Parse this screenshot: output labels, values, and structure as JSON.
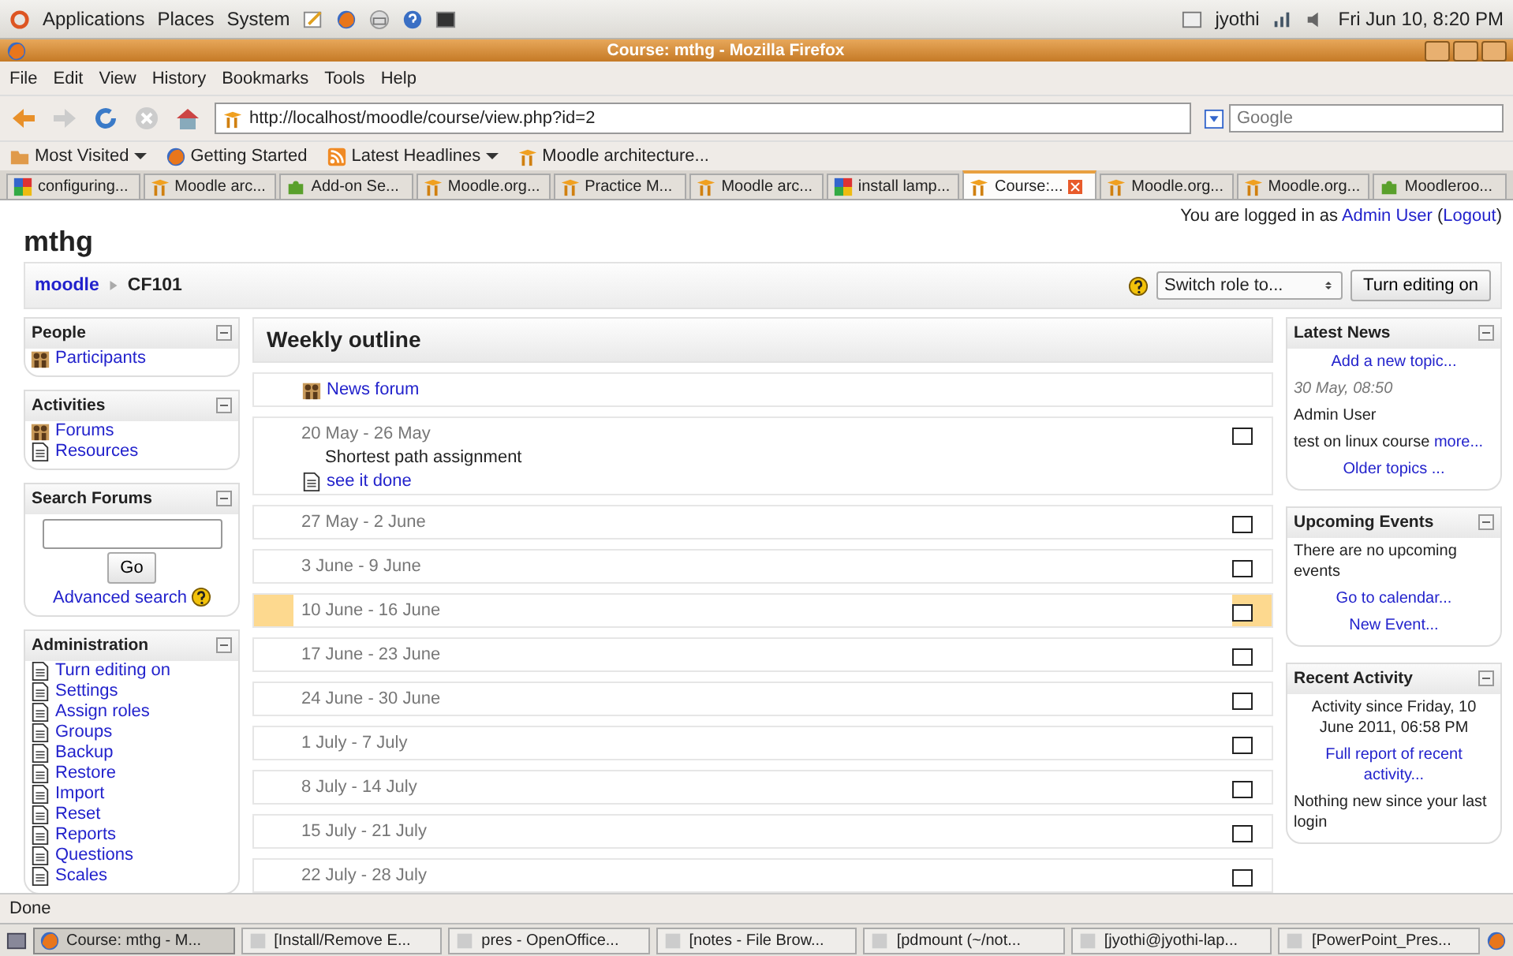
{
  "desktop_panel": {
    "menus": [
      "Applications",
      "Places",
      "System"
    ],
    "user": "jyothi",
    "clock": "Fri Jun 10, 8:20 PM"
  },
  "window": {
    "title": "Course: mthg - Mozilla Firefox"
  },
  "menu_bar": [
    "File",
    "Edit",
    "View",
    "History",
    "Bookmarks",
    "Tools",
    "Help"
  ],
  "address_bar": {
    "value": "http://localhost/moodle/course/view.php?id=2"
  },
  "search_bar": {
    "placeholder": "Google"
  },
  "bookmarks": [
    {
      "label": "Most Visited",
      "kind": "folder",
      "menu": true
    },
    {
      "label": "Getting Started",
      "kind": "firefox",
      "menu": false
    },
    {
      "label": "Latest Headlines",
      "kind": "feed",
      "menu": true
    },
    {
      "label": "Moodle architecture...",
      "kind": "moodle",
      "menu": false
    }
  ],
  "browser_tabs": [
    {
      "label": "configuring...",
      "kind": "google",
      "selected": false
    },
    {
      "label": "Moodle arc...",
      "kind": "moodle",
      "selected": false
    },
    {
      "label": "Add-on Se...",
      "kind": "addon",
      "selected": false
    },
    {
      "label": "Moodle.org...",
      "kind": "moodle",
      "selected": false
    },
    {
      "label": "Practice M...",
      "kind": "moodle",
      "selected": false
    },
    {
      "label": "Moodle arc...",
      "kind": "moodle",
      "selected": false
    },
    {
      "label": "install lamp...",
      "kind": "google",
      "selected": false
    },
    {
      "label": "Course:...",
      "kind": "moodle",
      "selected": true
    },
    {
      "label": "Moodle.org...",
      "kind": "moodle",
      "selected": false
    },
    {
      "label": "Moodle.org...",
      "kind": "moodle",
      "selected": false
    },
    {
      "label": "Moodleroo...",
      "kind": "addon",
      "selected": false
    }
  ],
  "page": {
    "site_title": "mthg",
    "login": {
      "prefix": "You are logged in as",
      "user": "Admin User",
      "open": "(",
      "logout": "Logout",
      "close": ")"
    },
    "breadcrumb": [
      {
        "label": "moodle",
        "link": true
      },
      {
        "label": "CF101",
        "link": false
      }
    ],
    "role_select": "Switch role to...",
    "edit_button": "Turn editing on",
    "left_blocks": [
      {
        "kind": "list",
        "title": "People",
        "items": [
          "Participants"
        ]
      },
      {
        "kind": "list",
        "title": "Activities",
        "items": [
          "Forums",
          "Resources"
        ]
      },
      {
        "kind": "search",
        "title": "Search Forums",
        "button": "Go",
        "link": "Advanced search"
      },
      {
        "kind": "list",
        "title": "Administration",
        "items": [
          "Turn editing on",
          "Settings",
          "Assign roles",
          "Groups",
          "Backup",
          "Restore",
          "Import",
          "Reset",
          "Reports",
          "Questions",
          "Scales"
        ]
      }
    ],
    "outline": {
      "title": "Weekly outline",
      "sections": [
        {
          "kind": "general",
          "items": [
            {
              "kind": "forum",
              "label": "News forum"
            }
          ]
        },
        {
          "kind": "week",
          "dates": "20 May - 26 May",
          "summary": "Shortest path assignment",
          "items": [
            {
              "kind": "resource",
              "label": "see it done"
            }
          ],
          "current": false
        },
        {
          "kind": "week",
          "dates": "27 May - 2 June",
          "current": false
        },
        {
          "kind": "week",
          "dates": "3 June - 9 June",
          "current": false
        },
        {
          "kind": "week",
          "dates": "10 June - 16 June",
          "current": true
        },
        {
          "kind": "week",
          "dates": "17 June - 23 June",
          "current": false
        },
        {
          "kind": "week",
          "dates": "24 June - 30 June",
          "current": false
        },
        {
          "kind": "week",
          "dates": "1 July - 7 July",
          "current": false
        },
        {
          "kind": "week",
          "dates": "8 July - 14 July",
          "current": false
        },
        {
          "kind": "week",
          "dates": "15 July - 21 July",
          "current": false
        },
        {
          "kind": "week",
          "dates": "22 July - 28 July",
          "current": false
        }
      ]
    },
    "right_blocks": [
      {
        "title": "Latest News",
        "lines": [
          {
            "kind": "link",
            "text": "Add a new topic..."
          },
          {
            "kind": "date",
            "text": "30 May, 08:50"
          },
          {
            "kind": "text",
            "text": "Admin User"
          },
          {
            "kind": "snippet",
            "text": "test on linux course",
            "link": "more..."
          },
          {
            "kind": "link",
            "text": "Older topics ..."
          }
        ]
      },
      {
        "title": "Upcoming Events",
        "lines": [
          {
            "kind": "text",
            "text": "There are no upcoming events"
          },
          {
            "kind": "link",
            "text": "Go to calendar..."
          },
          {
            "kind": "link",
            "text": "New Event..."
          }
        ]
      },
      {
        "title": "Recent Activity",
        "lines": [
          {
            "kind": "centered",
            "text": "Activity since Friday, 10 June 2011, 06:58 PM"
          },
          {
            "kind": "link",
            "text": "Full report of recent activity..."
          },
          {
            "kind": "text",
            "text": "Nothing new since your last login"
          }
        ]
      }
    ]
  },
  "status_bar": "Done",
  "taskbar": [
    {
      "label": "Course: mthg - M...",
      "selected": true
    },
    {
      "label": "[Install/Remove E...",
      "selected": false
    },
    {
      "label": "pres - OpenOffice...",
      "selected": false
    },
    {
      "label": "[notes - File Brow...",
      "selected": false
    },
    {
      "label": "[pdmount (~/not...",
      "selected": false
    },
    {
      "label": "[jyothi@jyothi-lap...",
      "selected": false
    },
    {
      "label": "[PowerPoint_Pres...",
      "selected": false
    }
  ]
}
